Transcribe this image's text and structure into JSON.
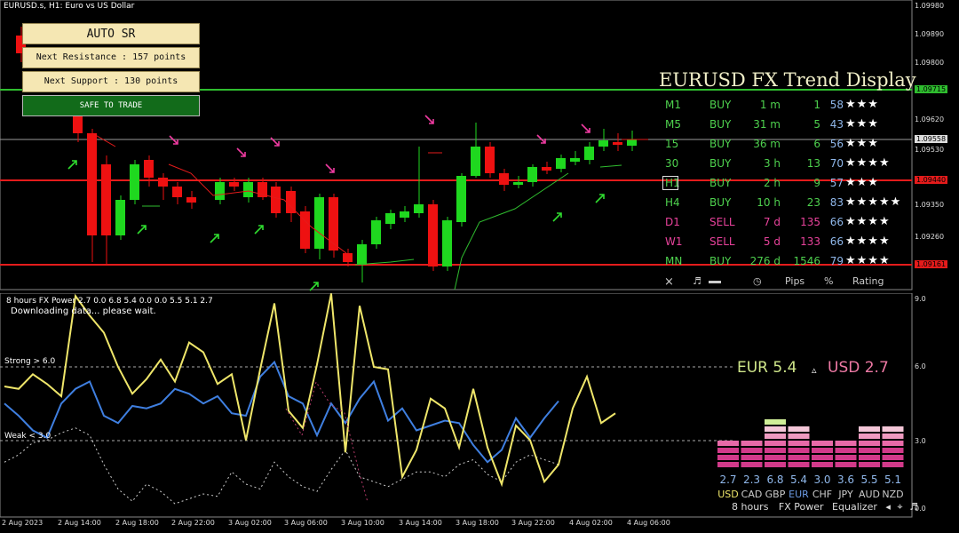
{
  "window": {
    "title": "EURUSD.s, H1:  Euro vs US Dollar"
  },
  "panel": {
    "auto_sr": "AUTO  SR",
    "next_resistance": "Next Resistance : 157 points",
    "next_support": "Next Support : 130 points",
    "safe_to_trade": "SAFE TO TRADE"
  },
  "price_axis": [
    "1.09980",
    "1.09890",
    "1.09800",
    "1.09715",
    "1.09620",
    "1.09558",
    "1.09530",
    "1.09440",
    "1.09350",
    "1.09260",
    "1.09161"
  ],
  "trend_display": {
    "title": "EURUSD FX Trend Display",
    "rows": [
      {
        "tf": "M1",
        "signal": "BUY",
        "time": "1 m",
        "pips": "1",
        "num": "58",
        "stars": "★★★"
      },
      {
        "tf": "M5",
        "signal": "BUY",
        "time": "31 m",
        "pips": "5",
        "num": "43",
        "stars": "★★★"
      },
      {
        "tf": "15",
        "signal": "BUY",
        "time": "36 m",
        "pips": "6",
        "num": "56",
        "stars": "★★★"
      },
      {
        "tf": "30",
        "signal": "BUY",
        "time": "3 h",
        "pips": "13",
        "num": "70",
        "stars": "★★★★"
      },
      {
        "tf": "H1",
        "signal": "BUY",
        "time": "2 h",
        "pips": "9",
        "num": "57",
        "stars": "★★★"
      },
      {
        "tf": "H4",
        "signal": "BUY",
        "time": "10 h",
        "pips": "23",
        "num": "83",
        "stars": "★★★★★"
      },
      {
        "tf": "D1",
        "signal": "SELL",
        "time": "7 d",
        "pips": "135",
        "num": "66",
        "stars": "★★★★"
      },
      {
        "tf": "W1",
        "signal": "SELL",
        "time": "5 d",
        "pips": "133",
        "num": "66",
        "stars": "★★★★"
      },
      {
        "tf": "MN",
        "signal": "BUY",
        "time": "276 d",
        "pips": "1546",
        "num": "79",
        "stars": "★★★★"
      }
    ],
    "header_pips": "Pips",
    "header_pct": "%",
    "header_rating": "Rating",
    "close_glyph": "×",
    "music_glyph": "♬",
    "clock_glyph": "◷",
    "buy_color": "#4ed14e",
    "sell_color": "#e8429b"
  },
  "indicator": {
    "title": "8 hours FX Power 2.7 0.0 6.8 5.4 0.0 0.0 5.5 5.1 2.7",
    "status": "Downloading data... please wait.",
    "strong_label": "Strong > 6.0",
    "weak_label": "Weak < 3.0",
    "axis": [
      "9.0",
      "6.0",
      "3.0",
      "0.0"
    ],
    "eur_label": "EUR 5.4",
    "usd_label": "USD 2.7",
    "delta_glyph": "▵"
  },
  "equalizer": {
    "values": [
      "2.7",
      "2.3",
      "6.8",
      "5.4",
      "3.0",
      "3.6",
      "5.5",
      "5.1"
    ],
    "currencies": [
      "USD",
      "CAD",
      "GBP",
      "EUR",
      "CHF",
      "JPY",
      "AUD",
      "NZD"
    ],
    "footer_hours": "8 hours",
    "footer_name": "FX Power",
    "footer_eq": "Equalizer",
    "footer_arrow": "◂",
    "footer_target": "⌖",
    "footer_music": "♬"
  },
  "time_axis": [
    "2 Aug 2023",
    "2 Aug 14:00",
    "2 Aug 18:00",
    "2 Aug 22:00",
    "3 Aug 02:00",
    "3 Aug 06:00",
    "3 Aug 10:00",
    "3 Aug 14:00",
    "3 Aug 18:00",
    "3 Aug 22:00",
    "4 Aug 02:00",
    "4 Aug 06:00"
  ],
  "colors": {
    "resistance": "#2fbd2f",
    "support_line": "#e41b1b",
    "bull_candle": "#1fd81f",
    "bear_candle": "#ee1111",
    "eur_line": "#3f7fe0",
    "usd_line": "#efe66a",
    "safe_bg": "#126b1a"
  }
}
